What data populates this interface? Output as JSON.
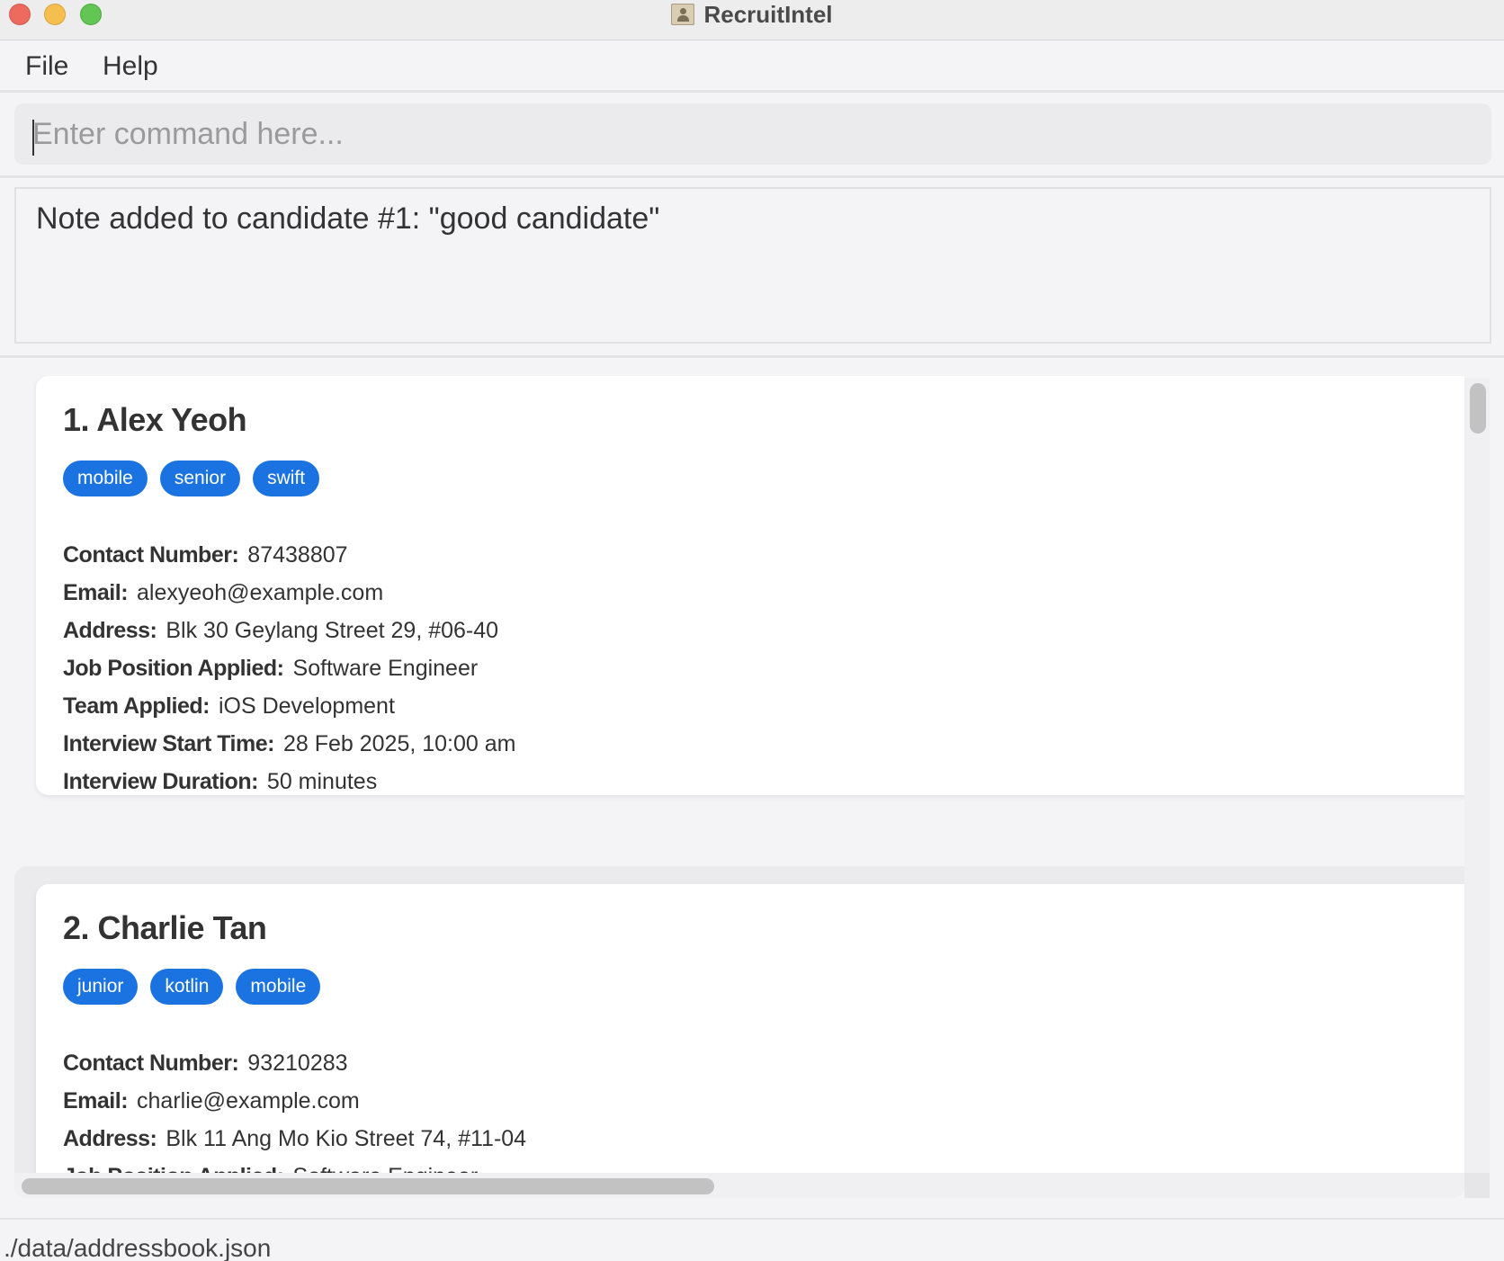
{
  "window": {
    "title": "RecruitIntel"
  },
  "menu": {
    "file": "File",
    "help": "Help"
  },
  "command": {
    "placeholder": "Enter command here..."
  },
  "result": {
    "message": "Note added to candidate #1: \"good candidate\""
  },
  "candidates": [
    {
      "name": "1. Alex Yeoh",
      "tags": [
        "mobile",
        "senior",
        "swift"
      ],
      "fields": [
        {
          "label": "Contact Number:",
          "value": "87438807"
        },
        {
          "label": "Email:",
          "value": "alexyeoh@example.com"
        },
        {
          "label": "Address:",
          "value": "Blk 30 Geylang Street 29, #06-40"
        },
        {
          "label": "Job Position Applied:",
          "value": "Software Engineer"
        },
        {
          "label": "Team Applied:",
          "value": "iOS Development"
        },
        {
          "label": "Interview Start Time:",
          "value": "28 Feb 2025, 10:00 am"
        },
        {
          "label": "Interview Duration:",
          "value": "50 minutes"
        }
      ]
    },
    {
      "name": "2. Charlie Tan",
      "tags": [
        "junior",
        "kotlin",
        "mobile"
      ],
      "fields": [
        {
          "label": "Contact Number:",
          "value": "93210283"
        },
        {
          "label": "Email:",
          "value": "charlie@example.com"
        },
        {
          "label": "Address:",
          "value": "Blk 11 Ang Mo Kio Street 74, #11-04"
        },
        {
          "label": "Job Position Applied:",
          "value": "Software Engineer"
        }
      ]
    }
  ],
  "status": {
    "path": "./data/addressbook.json"
  },
  "colors": {
    "tag_bg": "#1a73e0",
    "close": "#ed6a5e",
    "minimize": "#f5bf4f",
    "maximize": "#62c554"
  }
}
